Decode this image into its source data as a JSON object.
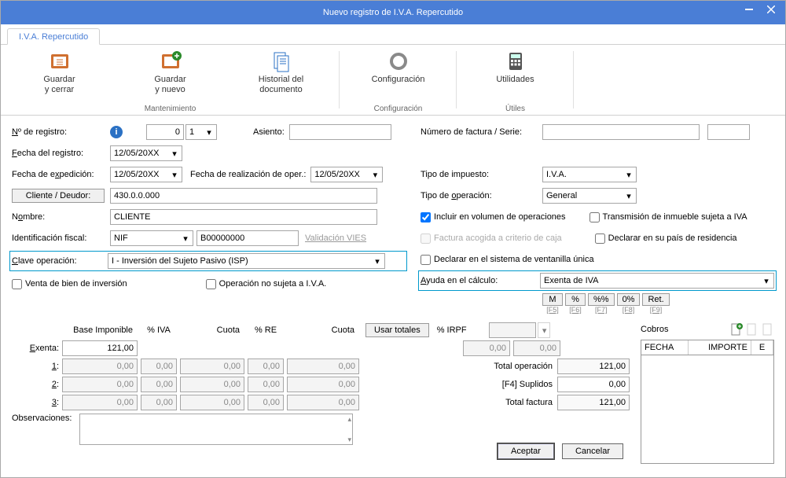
{
  "window": {
    "title": "Nuevo registro de I.V.A. Repercutido"
  },
  "tab": "I.V.A. Repercutido",
  "ribbon": {
    "guardarCerrar": "Guardar\ny cerrar",
    "guardarNuevo": "Guardar\ny nuevo",
    "historial": "Historial del\ndocumento",
    "config": "Configuración",
    "util": "Utilidades",
    "grpMant": "Mantenimiento",
    "grpConfig": "Configuración",
    "grpUtil": "Útiles"
  },
  "labels": {
    "nRegistro": "Nº de registro:",
    "asiento": "Asiento:",
    "numFactura": "Número de factura / Serie:",
    "fechaRegistro": "Fecha del registro:",
    "fechaExpedicion": "Fecha de expedición:",
    "fechaRealizacion": "Fecha de realización de oper.:",
    "tipoImpuesto": "Tipo de impuesto:",
    "clienteDeudor": "Cliente / Deudor:",
    "tipoOperacion": "Tipo de operación:",
    "nombre": "Nombre:",
    "identFiscal": "Identificación fiscal:",
    "validacion": "Validación VIES",
    "claveOperacion": "Clave operación:",
    "ventaBienInversion": "Venta de bien de inversión",
    "opNoSujeta": "Operación no sujeta a I.V.A.",
    "incluirVolumen": "Incluir en volumen de operaciones",
    "transmision": "Transmisión de inmueble sujeta a IVA",
    "facturaCriterio": "Factura acogida a criterio de caja",
    "declararPais": "Declarar en su país de residencia",
    "declararVentanilla": "Declarar en el sistema de ventanilla única",
    "ayudaCalc": "Ayuda en el cálculo:",
    "exenta": "Exenta:",
    "observ": "Observaciones:",
    "baseImponible": "Base Imponible",
    "pctIVA": "% IVA",
    "cuota": "Cuota",
    "pctRE": "% RE",
    "usarTotales": "Usar totales",
    "pctIRPF": "% IRPF",
    "totalOperacion": "Total operación",
    "suplidos": "[F4] Suplidos",
    "totalFactura": "Total factura",
    "cobros": "Cobros",
    "fecha": "FECHA",
    "importe": "IMPORTE",
    "e": "E",
    "l1": "1:",
    "l2": "2:",
    "l3": "3:"
  },
  "values": {
    "nReg1": "0",
    "nReg2": "1",
    "fechaRegistro": "12/05/20XX",
    "fechaExpedicion": "12/05/20XX",
    "fechaRealizacion": "12/05/20XX",
    "cliente": "430.0.0.000",
    "nombre": "CLIENTE",
    "idFiscalTipo": "NIF",
    "idFiscalNum": "B00000000",
    "claveOperacion": "I - Inversión del Sujeto Pasivo (ISP)",
    "tipoImpuesto": "I.V.A.",
    "tipoOperacion": "General",
    "ayudaCalc": "Exenta de IVA",
    "exenta": "121,00",
    "zero": "0,00",
    "totalOperacion": "121,00",
    "suplidos": "0,00",
    "totalFactura": "121,00",
    "incluirVolumen": true
  },
  "shortcuts": {
    "m": "M",
    "mK": "[F5]",
    "p": "%",
    "pK": "[F6]",
    "pp": "%%",
    "ppK": "[F7]",
    "z": "0%",
    "zK": "[F8]",
    "r": "Ret.",
    "rK": "[F9]"
  },
  "buttons": {
    "aceptar": "Aceptar",
    "cancelar": "Cancelar"
  }
}
